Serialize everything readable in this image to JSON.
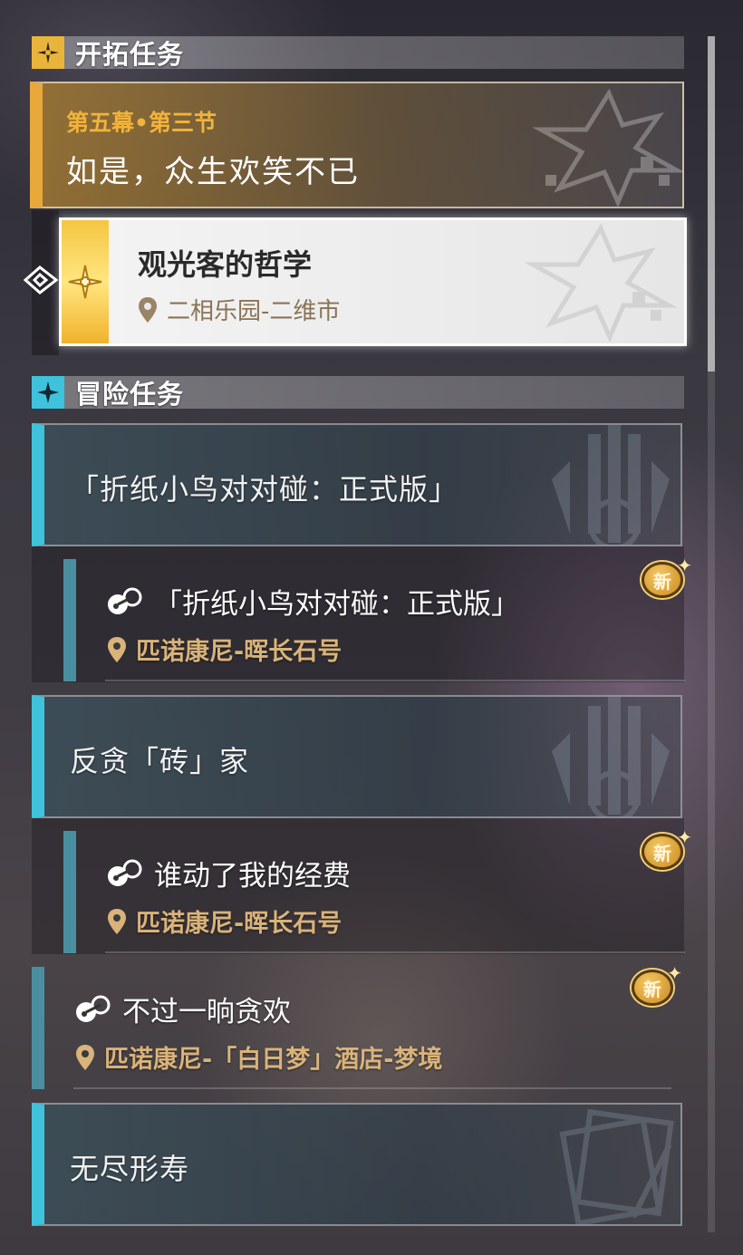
{
  "trailblaze_section": {
    "label": "开拓任务"
  },
  "chapter": {
    "subtitle": "第五幕•第三节",
    "title": "如是，众生欢笑不已"
  },
  "selected_quest": {
    "title": "观光客的哲学",
    "location": "二相乐园-二维市"
  },
  "adventure_section": {
    "label": "冒险任务"
  },
  "adventure_groups": [
    {
      "title": "「折纸小鸟对对碰：正式版」"
    },
    {
      "title": "反贪「砖」家"
    },
    {
      "title": "无尽形寿"
    }
  ],
  "adventure_quests": [
    {
      "title": "「折纸小鸟对对碰：正式版」",
      "location": "匹诺康尼-晖长石号",
      "badge": "新"
    },
    {
      "title": "谁动了我的经费",
      "location": "匹诺康尼-晖长石号",
      "badge": "新"
    },
    {
      "title": "不过一晌贪欢",
      "location": "匹诺康尼-「白日梦」酒店-梦境",
      "badge": "新"
    }
  ],
  "colors": {
    "trailblaze_accent": "#e8b43a",
    "adventure_accent": "#3fc2dc",
    "location_text": "#d9b37a"
  },
  "icons": [
    "trailblaze-icon",
    "adventure-icon",
    "selection-pointer-icon",
    "quest-type-icon",
    "location-pin-icon",
    "new-badge-icon"
  ]
}
